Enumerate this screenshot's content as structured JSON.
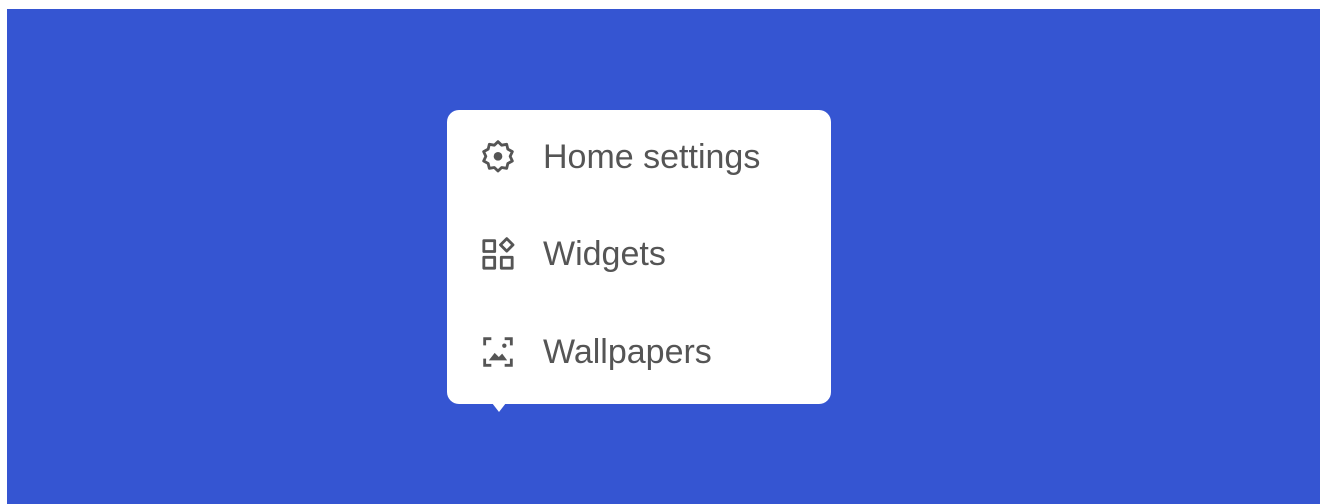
{
  "colors": {
    "background": "#3555d2",
    "menu_background": "#ffffff",
    "text": "#555555",
    "icon": "#555555"
  },
  "menu": {
    "items": [
      {
        "label": "Home settings",
        "icon": "gear-icon"
      },
      {
        "label": "Widgets",
        "icon": "widgets-icon"
      },
      {
        "label": "Wallpapers",
        "icon": "wallpaper-icon"
      }
    ]
  }
}
